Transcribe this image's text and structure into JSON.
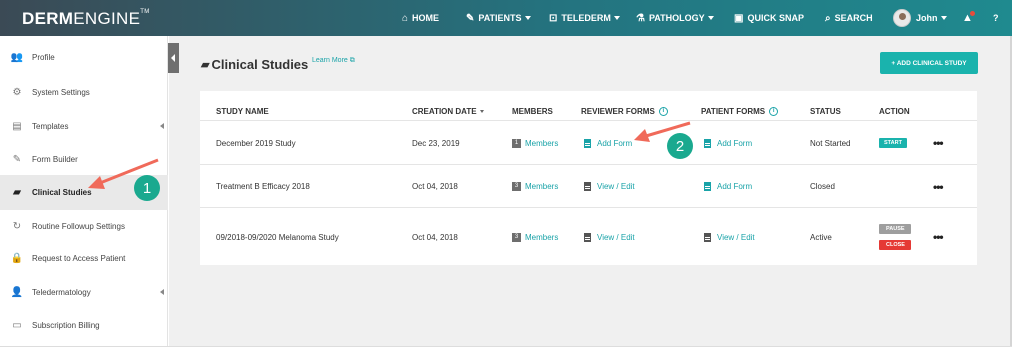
{
  "brand": {
    "bold": "DERM",
    "light": "ENGINE",
    "tm": "TM"
  },
  "nav": {
    "home": "HOME",
    "patients": "PATIENTS",
    "telederm": "TELEDERM",
    "pathology": "PATHOLOGY",
    "quick_snap": "QUICK SNAP",
    "search": "SEARCH",
    "user": "John",
    "help": "?"
  },
  "sidebar": {
    "items": [
      {
        "label": "Profile",
        "icon": "users-icon"
      },
      {
        "label": "System Settings",
        "icon": "gear-icon"
      },
      {
        "label": "Templates",
        "icon": "document-icon"
      },
      {
        "label": "Form Builder",
        "icon": "edit-form-icon"
      },
      {
        "label": "Clinical Studies",
        "icon": "folder-icon"
      },
      {
        "label": "Routine Followup Settings",
        "icon": "refresh-icon"
      },
      {
        "label": "Request to Access Patient",
        "icon": "lock-icon"
      },
      {
        "label": "Teledermatology",
        "icon": "user-settings-icon"
      },
      {
        "label": "Subscription Billing",
        "icon": "credit-card-icon"
      }
    ]
  },
  "page": {
    "title": "Clinical Studies",
    "learn_more": "Learn More",
    "add_button": "+ ADD CLINICAL STUDY"
  },
  "table": {
    "headers": {
      "study_name": "STUDY NAME",
      "creation_date": "CREATION DATE",
      "members": "MEMBERS",
      "reviewer_forms": "REVIEWER FORMS",
      "patient_forms": "PATIENT FORMS",
      "status": "STATUS",
      "action": "ACTION"
    },
    "rows": [
      {
        "name": "December 2019 Study",
        "date": "Dec 23, 2019",
        "member_count": "1",
        "members": "Members",
        "reviewer_form": "Add Form",
        "patient_form": "Add Form",
        "status": "Not Started",
        "action1": "START",
        "action2": "",
        "more": "•••"
      },
      {
        "name": "Treatment B Efficacy 2018",
        "date": "Oct 04, 2018",
        "member_count": "3",
        "members": "Members",
        "reviewer_form": "View / Edit",
        "patient_form": "Add Form",
        "status": "Closed",
        "action1": "",
        "action2": "",
        "more": "•••"
      },
      {
        "name": "09/2018-09/2020 Melanoma Study",
        "date": "Oct 04, 2018",
        "member_count": "3",
        "members": "Members",
        "reviewer_form": "View / Edit",
        "patient_form": "View / Edit",
        "status": "Active",
        "action1": "PAUSE",
        "action2": "CLOSE",
        "more": "•••"
      }
    ]
  },
  "callouts": {
    "one": "1",
    "two": "2"
  },
  "colors": {
    "accent": "#1ab3ad",
    "callout": "#1aa98f",
    "arrow": "#f06a5a",
    "close": "#e53935"
  }
}
